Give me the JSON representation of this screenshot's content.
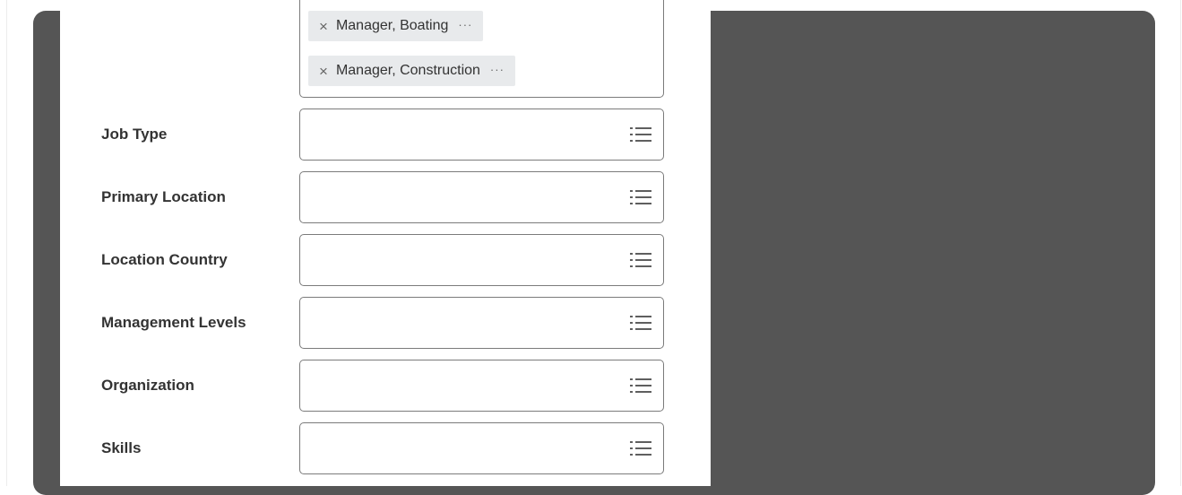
{
  "tags": [
    {
      "label": "Manager, Boating",
      "more": "···",
      "remove": "×"
    },
    {
      "label": "Manager, Construction",
      "more": "···",
      "remove": "×"
    }
  ],
  "fields": [
    {
      "label": "Job Type",
      "value": ""
    },
    {
      "label": "Primary Location",
      "value": ""
    },
    {
      "label": "Location Country",
      "value": ""
    },
    {
      "label": "Management Levels",
      "value": ""
    },
    {
      "label": "Organization",
      "value": ""
    },
    {
      "label": "Skills",
      "value": ""
    }
  ],
  "icons": {
    "prompt": "list-icon"
  },
  "colors": {
    "overlay": "#555555",
    "tag_bg": "#e8eaec",
    "border": "#7b7b7b",
    "label_text": "#333333"
  }
}
